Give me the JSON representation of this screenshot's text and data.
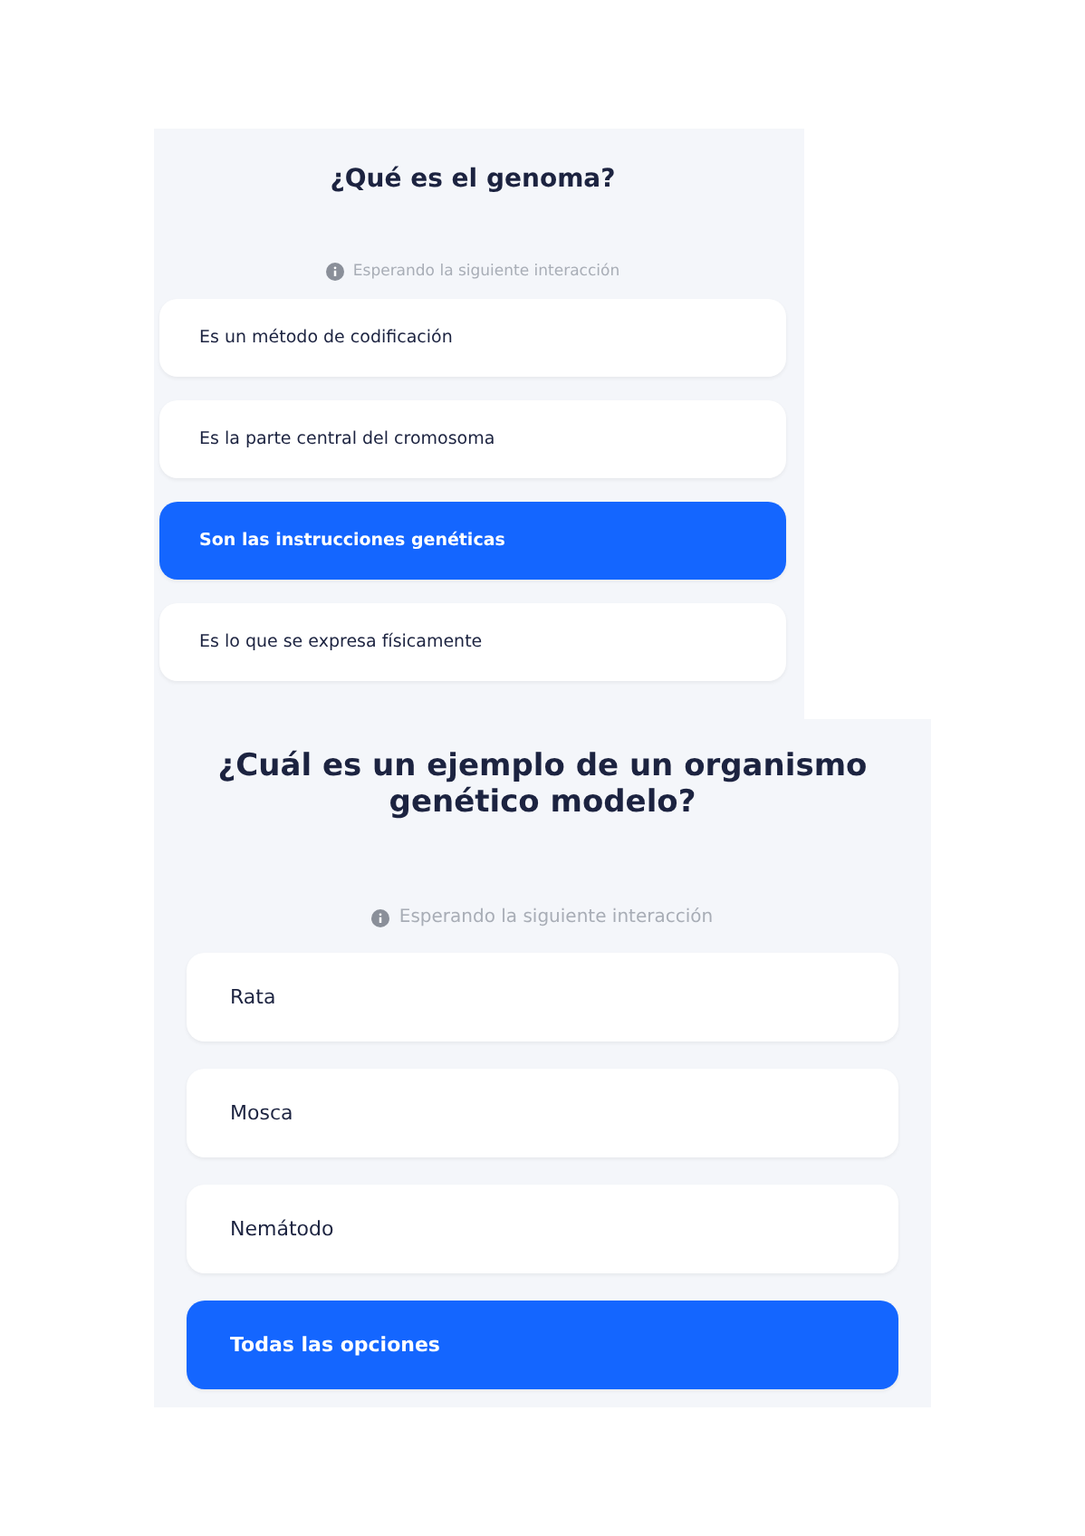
{
  "questions": [
    {
      "title": "¿Qué es el genoma?",
      "status": "Esperando la siguiente interacción",
      "options": [
        {
          "label": "Es un método de codificación",
          "selected": false
        },
        {
          "label": "Es la parte central del cromosoma",
          "selected": false
        },
        {
          "label": "Son las instrucciones genéticas",
          "selected": true
        },
        {
          "label": "Es lo que se expresa físicamente",
          "selected": false
        }
      ]
    },
    {
      "title": "¿Cuál es un ejemplo de un organismo genético modelo?",
      "status": "Esperando la siguiente interacción",
      "options": [
        {
          "label": "Rata",
          "selected": false
        },
        {
          "label": "Mosca",
          "selected": false
        },
        {
          "label": "Nemátodo",
          "selected": false
        },
        {
          "label": "Todas las opciones",
          "selected": true
        }
      ]
    }
  ]
}
